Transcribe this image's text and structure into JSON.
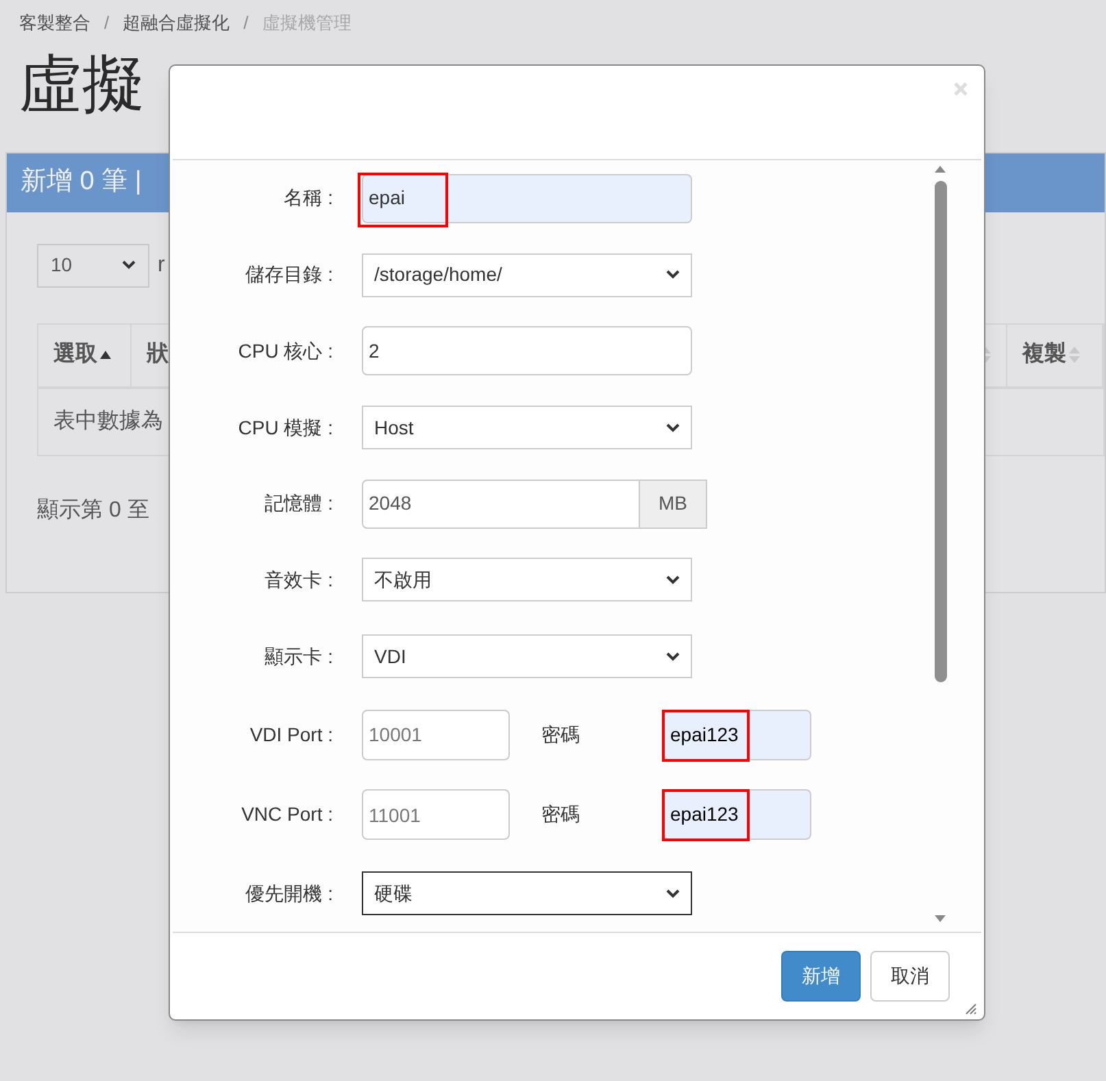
{
  "breadcrumb": [
    {
      "label": "客製整合",
      "current": false
    },
    {
      "label": "超融合虛擬化",
      "current": false
    },
    {
      "label": "虛擬機管理",
      "current": true
    }
  ],
  "breadcrumb_separator": "/",
  "page_title": "虛擬",
  "toolbar": {
    "text": "新增 0 筆 |"
  },
  "page_length": {
    "value": "10",
    "suffix": "r"
  },
  "table": {
    "columns": [
      {
        "label": "選取",
        "sorted": true
      },
      {
        "label": "狀",
        "sorted": false
      },
      {
        "label": "複製",
        "sorted": false
      }
    ],
    "empty_text": "表中數據為"
  },
  "info_text": "顯示第 0 至",
  "dialog": {
    "fields": [
      {
        "kind": "text",
        "label": "名稱 :",
        "value": "epai",
        "highlight": true,
        "autofill": true
      },
      {
        "kind": "select",
        "label": "儲存目錄 :",
        "value": "/storage/home/",
        "focused": false
      },
      {
        "kind": "text",
        "label": "CPU 核心 :",
        "value": "2",
        "highlight": false,
        "autofill": false
      },
      {
        "kind": "select",
        "label": "CPU 模擬 :",
        "value": "Host",
        "focused": false
      },
      {
        "kind": "addon",
        "label": "記憶體 :",
        "value": "2048",
        "addon": "MB"
      },
      {
        "kind": "select",
        "label": "音效卡 :",
        "value": "不啟用",
        "focused": false
      },
      {
        "kind": "select",
        "label": "顯示卡 :",
        "value": "VDI",
        "focused": false
      },
      {
        "kind": "port",
        "label": "VDI Port :",
        "placeholder": "10001",
        "password_label": "密碼",
        "password": "epai123",
        "highlight": true
      },
      {
        "kind": "port",
        "label": "VNC Port :",
        "placeholder": "11001",
        "password_label": "密碼",
        "password": "epai123",
        "highlight": true
      },
      {
        "kind": "select",
        "label": "優先開機 :",
        "value": "硬碟",
        "focused": true
      }
    ],
    "buttons": [
      {
        "label": "新增",
        "primary": true
      },
      {
        "label": "取消",
        "primary": false
      }
    ]
  }
}
